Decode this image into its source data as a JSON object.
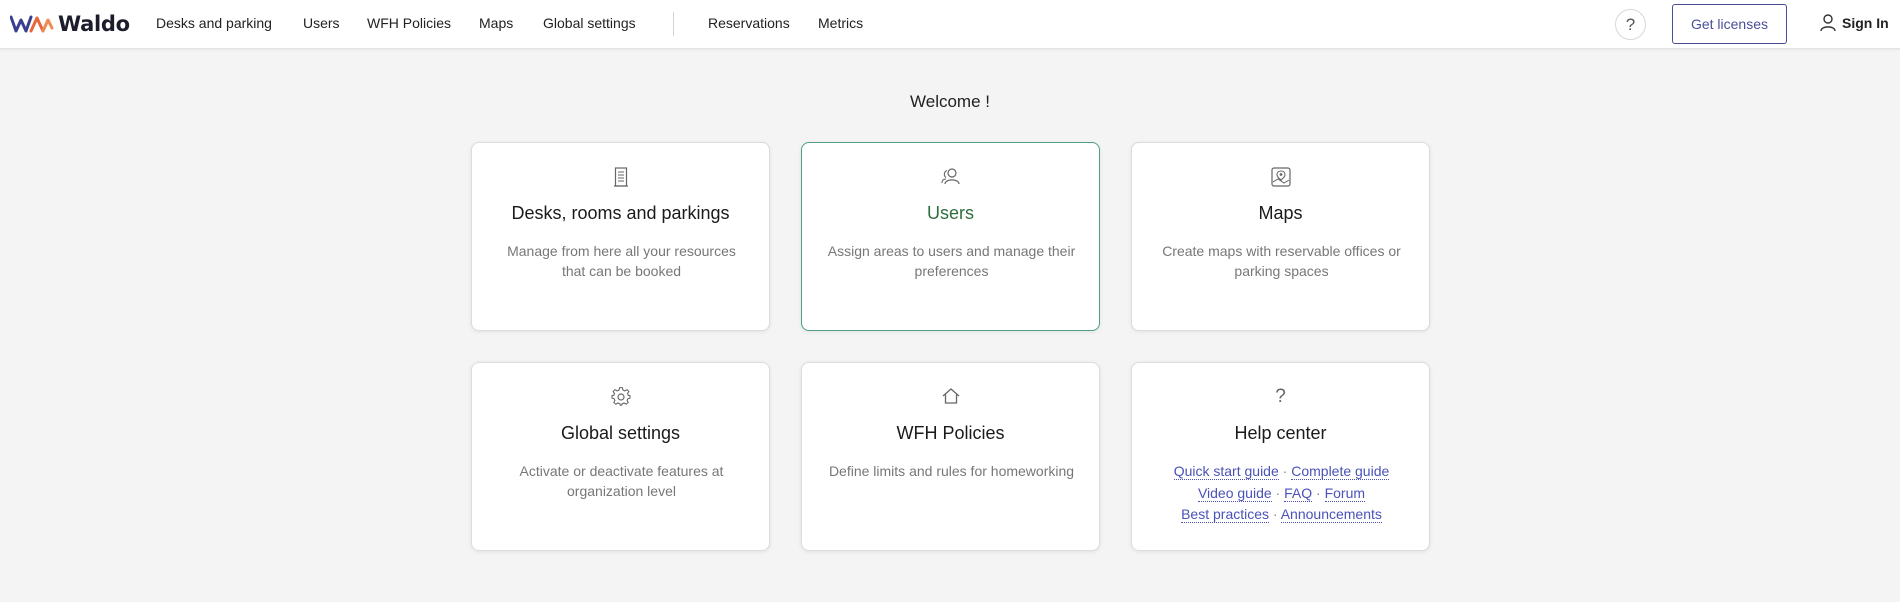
{
  "app": {
    "name": "Waldo",
    "brand_colors": {
      "purple": "#3a3f8f",
      "orange": "#e8663a",
      "accent_green": "#2f6e3e"
    }
  },
  "nav": {
    "items": [
      {
        "label": "Desks and parking"
      },
      {
        "label": "Users"
      },
      {
        "label": "WFH Policies"
      },
      {
        "label": "Maps"
      },
      {
        "label": "Global settings"
      },
      {
        "label": "Reservations"
      },
      {
        "label": "Metrics"
      }
    ],
    "help_icon": "question-mark-icon",
    "get_licenses_label": "Get licenses",
    "sign_in_label": "Sign In",
    "sign_in_icon": "user-icon"
  },
  "main": {
    "welcome": "Welcome !",
    "cards": [
      {
        "icon": "building-icon",
        "title": "Desks, rooms and parkings",
        "description": "Manage from here all your resources that can be booked"
      },
      {
        "icon": "users-icon",
        "title": "Users",
        "description": "Assign areas to users and manage their preferences"
      },
      {
        "icon": "map-icon",
        "title": "Maps",
        "description": "Create maps with reservable offices or parking spaces"
      },
      {
        "icon": "gear-icon",
        "title": "Global settings",
        "description": "Activate or deactivate features at organization level"
      },
      {
        "icon": "home-icon",
        "title": "WFH Policies",
        "description": "Define limits and rules for homeworking"
      },
      {
        "icon": "question-mark-icon",
        "title": "Help center",
        "links": {
          "quick_start": "Quick start guide",
          "complete_guide": "Complete guide",
          "video_guide": "Video guide",
          "faq": "FAQ",
          "forum": "Forum",
          "best_practices": "Best practices",
          "announcements": "Announcements",
          "separator": "·"
        }
      }
    ]
  }
}
